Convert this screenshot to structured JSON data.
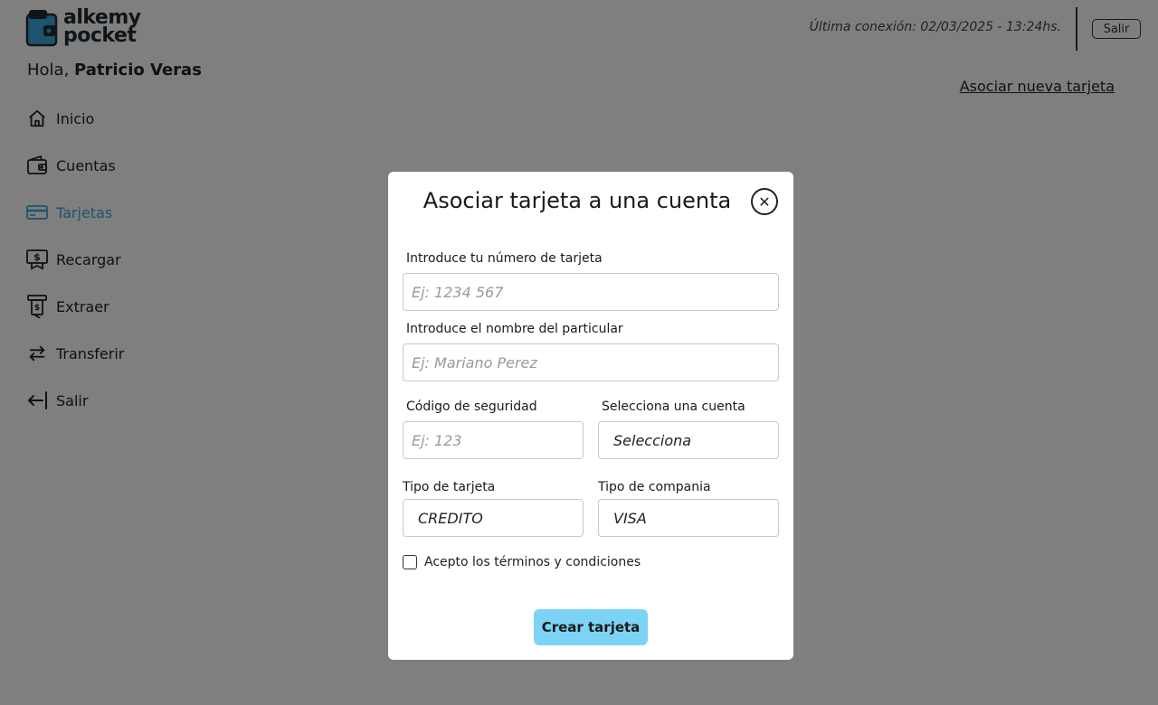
{
  "app": {
    "logo_line1": "alkemy",
    "logo_line2": "pocket",
    "last_connection": "Última conexión: 02/03/2025 - 13:24hs.",
    "logout_label": "Salir",
    "greeting_prefix": "Hola,",
    "user_name": "Patricio Veras",
    "accent_color": "#3aa7d9"
  },
  "sidebar": {
    "items": [
      {
        "label": "Inicio",
        "icon": "home-icon"
      },
      {
        "label": "Cuentas",
        "icon": "wallet-icon"
      },
      {
        "label": "Tarjetas",
        "icon": "card-icon",
        "active": true
      },
      {
        "label": "Recargar",
        "icon": "recharge-icon"
      },
      {
        "label": "Extraer",
        "icon": "withdraw-icon"
      },
      {
        "label": "Transferir",
        "icon": "transfer-icon"
      },
      {
        "label": "Salir",
        "icon": "logout-icon"
      }
    ]
  },
  "main": {
    "associate_link": "Asociar nueva tarjeta"
  },
  "modal": {
    "title": "Asociar tarjeta a una cuenta",
    "card_number_label": "Introduce tu número de tarjeta",
    "card_number_placeholder": "Ej: 1234 567",
    "holder_name_label": "Introduce el nombre del particular",
    "holder_name_placeholder": "Ej: Mariano Perez",
    "security_code_label": "Código de seguridad",
    "security_code_placeholder": "Ej: 123",
    "account_label": "Selecciona una cuenta",
    "account_value": "Selecciona",
    "card_type_label": "Tipo de tarjeta",
    "card_type_value": "CREDITO",
    "company_label": "Tipo de compania",
    "company_value": "VISA",
    "terms_label": "Acepto los términos y condiciones",
    "terms_checked": false,
    "submit_label": "Crear tarjeta",
    "submit_color": "#7dd3f5"
  }
}
